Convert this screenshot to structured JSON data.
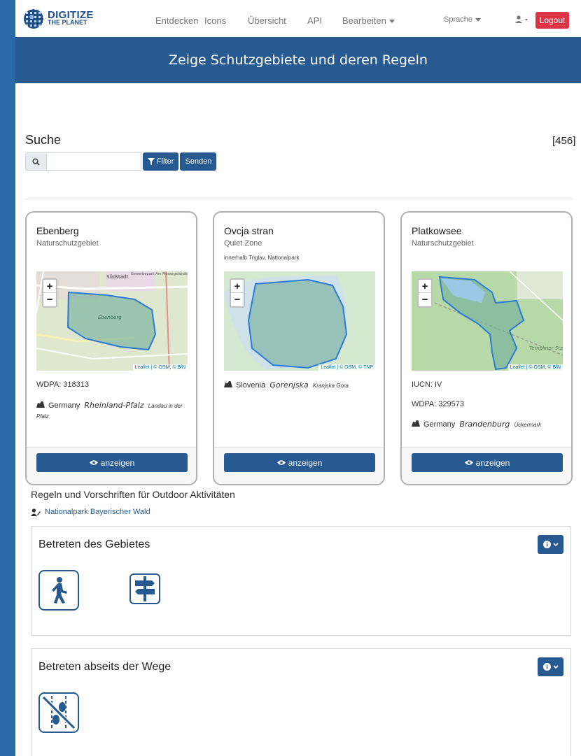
{
  "nav": {
    "logo_line1": "DIGITIZE",
    "logo_line2": "THE PLANET",
    "links": [
      "Entdecken",
      "Icons",
      "Übersicht",
      "API",
      "Bearbeiten"
    ],
    "language": "Sprache",
    "logout": "Logout"
  },
  "banner": {
    "title": "Zeige Schutzgebiete und deren Regeln"
  },
  "search": {
    "title": "Suche",
    "count": "[456]",
    "input_value": "",
    "filter_label": "Filter",
    "submit_label": "Senden"
  },
  "cards": [
    {
      "title": "Ebenberg",
      "type": "Naturschutzgebiet",
      "note": "",
      "attribution": "Leaflet | © OSM, © BfN",
      "lines": [
        "WDPA: 318313"
      ],
      "country": "Germany",
      "region": "Rheinland-Pfalz",
      "district": "Landau in der Pfalz",
      "button": "anzeigen"
    },
    {
      "title": "Ovcja stran",
      "type": "Quiet Zone",
      "note": "innerhalb Triglav, Nationalpark",
      "attribution": "Leaflet | © OSM, © TNP",
      "lines": [],
      "country": "Slovenia",
      "region": "Gorenjska",
      "district": "Kranjska Gora",
      "button": "anzeigen"
    },
    {
      "title": "Platkowsee",
      "type": "Naturschutzgebiet",
      "note": "",
      "attribution": "Leaflet | © OSM, © BfN",
      "lines": [
        "IUCN: IV",
        "WDPA: 329573"
      ],
      "country": "Germany",
      "region": "Brandenburg",
      "district": "Uckermark",
      "button": "anzeigen"
    }
  ],
  "map_labels": {
    "map1_a": "Südstadt",
    "map1_b": "Gewerbepark Am Messegelände",
    "map1_c": "Ebenberg",
    "map3_a": "Templiner Stadtforst"
  },
  "rules": {
    "title": "Regeln und Vorschriften für Outdoor Aktivitäten",
    "park": "Nationalpark Bayerischer Wald",
    "sections": [
      {
        "title": "Betreten des Gebietes",
        "icons": [
          "walking-person-icon",
          "signpost-icon"
        ]
      },
      {
        "title": "Betreten abseits der Wege",
        "icons": [
          "no-offtrail-footprints-icon"
        ]
      }
    ]
  },
  "colors": {
    "primary": "#275a91",
    "danger": "#dc3545",
    "outer": "#2a6aa8"
  }
}
